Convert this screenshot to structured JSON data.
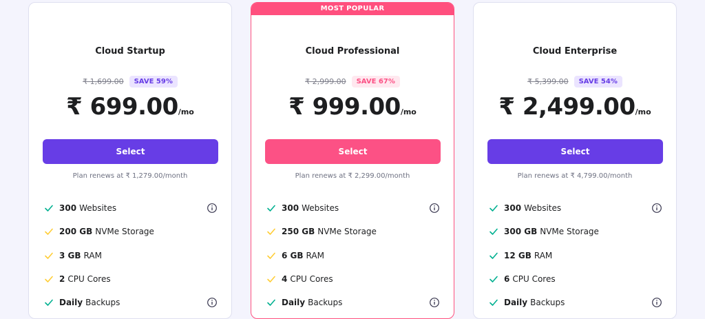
{
  "colors": {
    "background": "#f4f4fd",
    "purple_accent": "#673de6",
    "pink_accent": "#fc5185",
    "check_green": "#00b090",
    "check_yellow": "#ffcd35"
  },
  "plans": [
    {
      "name": "Cloud Startup",
      "old_price": "₹ 1,699.00",
      "save": "SAVE 59%",
      "price": "₹ 699.00",
      "per": "/mo",
      "button": "Select",
      "renew": "Plan renews at ₹ 1,279.00/month",
      "features": [
        {
          "bold": "300",
          "text": "Websites",
          "check": "green",
          "info": true
        },
        {
          "bold": "200 GB",
          "text": "NVMe Storage",
          "check": "yellow",
          "info": false
        },
        {
          "bold": "3 GB",
          "text": "RAM",
          "check": "yellow",
          "info": false
        },
        {
          "bold": "2",
          "text": "CPU Cores",
          "check": "yellow",
          "info": false
        },
        {
          "bold": "Daily",
          "text": "Backups",
          "check": "green",
          "info": true
        }
      ]
    },
    {
      "name": "Cloud Professional",
      "badge": "MOST POPULAR",
      "old_price": "₹ 2,999.00",
      "save": "SAVE 67%",
      "price": "₹ 999.00",
      "per": "/mo",
      "button": "Select",
      "renew": "Plan renews at ₹ 2,299.00/month",
      "features": [
        {
          "bold": "300",
          "text": "Websites",
          "check": "green",
          "info": true
        },
        {
          "bold": "250 GB",
          "text": "NVMe Storage",
          "check": "yellow",
          "info": false
        },
        {
          "bold": "6 GB",
          "text": "RAM",
          "check": "yellow",
          "info": false
        },
        {
          "bold": "4",
          "text": "CPU Cores",
          "check": "yellow",
          "info": false
        },
        {
          "bold": "Daily",
          "text": "Backups",
          "check": "green",
          "info": true
        }
      ]
    },
    {
      "name": "Cloud Enterprise",
      "old_price": "₹ 5,399.00",
      "save": "SAVE 54%",
      "price": "₹ 2,499.00",
      "per": "/mo",
      "button": "Select",
      "renew": "Plan renews at ₹ 4,799.00/month",
      "features": [
        {
          "bold": "300",
          "text": "Websites",
          "check": "green",
          "info": true
        },
        {
          "bold": "300 GB",
          "text": "NVMe Storage",
          "check": "green",
          "info": false
        },
        {
          "bold": "12 GB",
          "text": "RAM",
          "check": "green",
          "info": false
        },
        {
          "bold": "6",
          "text": "CPU Cores",
          "check": "green",
          "info": false
        },
        {
          "bold": "Daily",
          "text": "Backups",
          "check": "green",
          "info": true
        }
      ]
    }
  ],
  "icons": {
    "check": "check-icon",
    "info": "info-icon"
  }
}
